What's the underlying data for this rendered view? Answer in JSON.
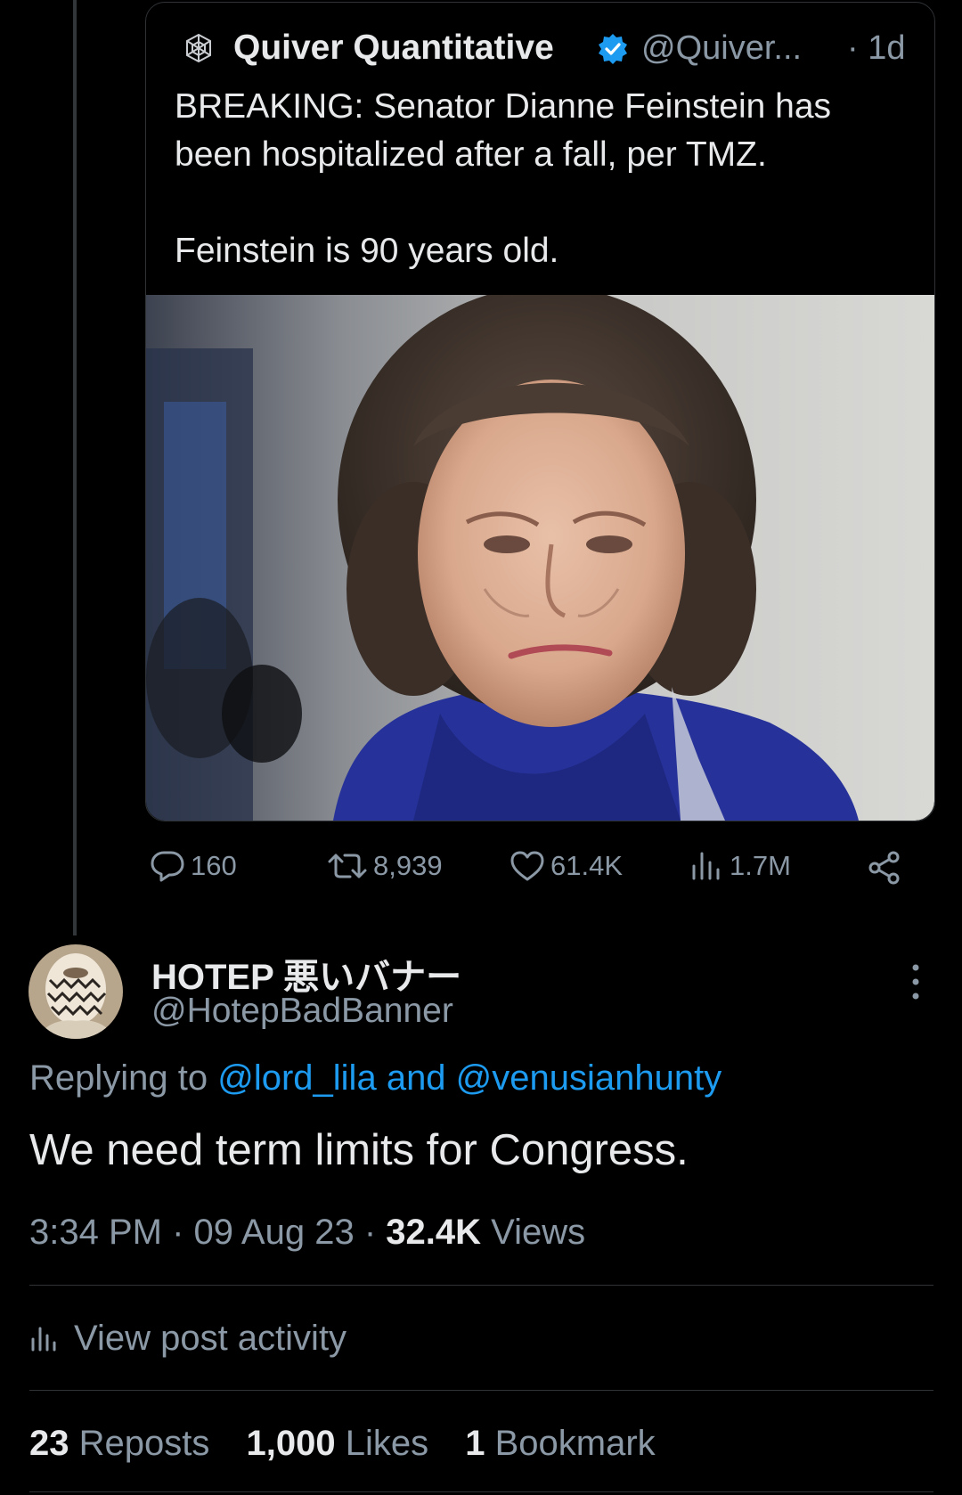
{
  "quoted_tweet": {
    "author_name": "Quiver Quantitative",
    "handle": "@Quiver...",
    "time": "· 1d",
    "text_line1": "BREAKING: Senator Dianne Feinstein has",
    "text_line2": "been hospitalized after a fall, per TMZ.",
    "text_line3": "Feinstein is 90 years old.",
    "image_description_icon": "portrait-photo"
  },
  "actions": {
    "replies": "160",
    "reposts": "8,939",
    "likes": "61.4K",
    "views": "1.7M"
  },
  "tweet": {
    "author_name": "HOTEP 悪いバナー",
    "handle": "@HotepBadBanner",
    "replying_prefix": "Replying to ",
    "mention1": "@lord_lila",
    "replying_and": " and ",
    "mention2": "@venusianhunty",
    "text": "We need term limits for Congress.",
    "time": "3:34 PM",
    "sep1": " · ",
    "date": "09 Aug 23",
    "sep2": " · ",
    "views_count": "32.4K",
    "views_label": " Views",
    "view_activity": "View post activity",
    "reposts_count": "23",
    "reposts_label": " Reposts",
    "likes_count": "1,000",
    "likes_label": " Likes",
    "bookmarks_count": "1",
    "bookmarks_label": " Bookmark"
  },
  "colors": {
    "background": "#000000",
    "text": "#e7e9ea",
    "muted": "#8b98a5",
    "accent": "#1d9bf0"
  }
}
